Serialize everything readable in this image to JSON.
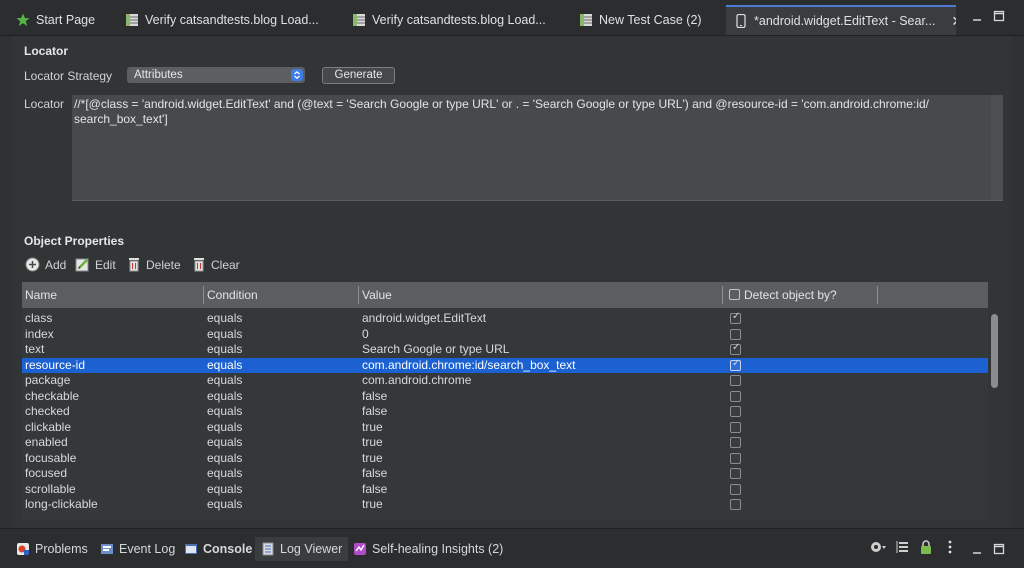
{
  "tabs": [
    {
      "label": "Start Page",
      "icon": "star-icon"
    },
    {
      "label": "Verify catsandtests.blog Load...",
      "icon": "test-suite-icon"
    },
    {
      "label": "Verify catsandtests.blog Load...",
      "icon": "test-suite-icon"
    },
    {
      "label": "New Test Case (2)",
      "icon": "test-suite-icon"
    },
    {
      "label": "*android.widget.EditText - Sear...",
      "icon": "phone-icon",
      "active": true
    }
  ],
  "locator": {
    "section_title": "Locator",
    "strategy_label": "Locator Strategy",
    "strategy_value": "Attributes",
    "generate_label": "Generate",
    "locator_label": "Locator",
    "locator_value": "//*[@class = 'android.widget.EditText' and (@text = 'Search Google or type URL' or . = 'Search Google or type URL') and @resource-id = 'com.android.chrome:id/\nsearch_box_text']"
  },
  "object_properties": {
    "section_title": "Object Properties",
    "toolbar": {
      "add": "Add",
      "edit": "Edit",
      "delete": "Delete",
      "clear": "Clear"
    },
    "columns": {
      "name": "Name",
      "condition": "Condition",
      "value": "Value",
      "detect": "Detect object by?"
    },
    "rows": [
      {
        "name": "class",
        "condition": "equals",
        "value": "android.widget.EditText",
        "checked": true
      },
      {
        "name": "index",
        "condition": "equals",
        "value": "0",
        "checked": false
      },
      {
        "name": "text",
        "condition": "equals",
        "value": "Search Google or type URL",
        "checked": true
      },
      {
        "name": "resource-id",
        "condition": "equals",
        "value": "com.android.chrome:id/search_box_text",
        "checked": true,
        "selected": true
      },
      {
        "name": "package",
        "condition": "equals",
        "value": "com.android.chrome",
        "checked": false
      },
      {
        "name": "checkable",
        "condition": "equals",
        "value": "false",
        "checked": false
      },
      {
        "name": "checked",
        "condition": "equals",
        "value": "false",
        "checked": false
      },
      {
        "name": "clickable",
        "condition": "equals",
        "value": "true",
        "checked": false
      },
      {
        "name": "enabled",
        "condition": "equals",
        "value": "true",
        "checked": false
      },
      {
        "name": "focusable",
        "condition": "equals",
        "value": "true",
        "checked": false
      },
      {
        "name": "focused",
        "condition": "equals",
        "value": "false",
        "checked": false
      },
      {
        "name": "scrollable",
        "condition": "equals",
        "value": "false",
        "checked": false
      },
      {
        "name": "long-clickable",
        "condition": "equals",
        "value": "true",
        "checked": false
      }
    ]
  },
  "bottom_tabs": [
    {
      "label": "Problems",
      "icon": "problems-icon"
    },
    {
      "label": "Event Log",
      "icon": "event-log-icon"
    },
    {
      "label": "Console",
      "icon": "console-icon",
      "bold": true
    },
    {
      "label": "Log Viewer",
      "icon": "log-viewer-icon",
      "active": true
    },
    {
      "label": "Self-healing Insights (2)",
      "icon": "self-healing-icon"
    }
  ],
  "colors": {
    "selection": "#1b61d2",
    "accent": "#4e7bd6"
  }
}
